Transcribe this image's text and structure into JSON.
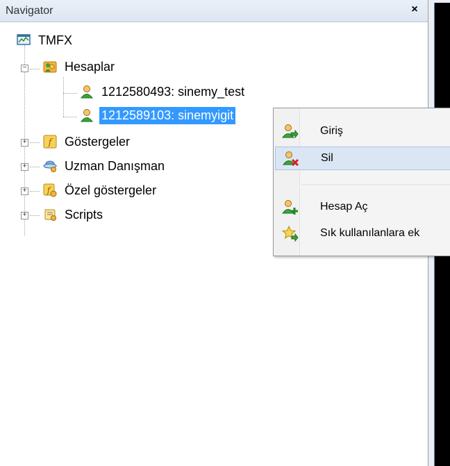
{
  "panel": {
    "title": "Navigator",
    "close_label": "×"
  },
  "tree": {
    "root": "TMFX",
    "accounts_group": "Hesaplar",
    "accounts": [
      {
        "label": "1212580493: sinemy_test",
        "selected": false
      },
      {
        "label": "1212589103: sinemyigit",
        "selected": true
      }
    ],
    "groups": [
      {
        "label": "Göstergeler",
        "icon": "indicator-icon"
      },
      {
        "label": "Uzman Danışman",
        "icon": "expert-advisor-icon"
      },
      {
        "label": "Özel göstergeler",
        "icon": "custom-indicator-icon"
      },
      {
        "label": "Scripts",
        "icon": "script-icon"
      }
    ]
  },
  "context_menu": {
    "items": [
      {
        "label": "Giriş",
        "icon": "user-login-icon"
      },
      {
        "label": "Sil",
        "icon": "user-delete-icon",
        "highlighted": true
      },
      {
        "label": "Hesap Aç",
        "icon": "user-add-icon"
      },
      {
        "label": "Sık kullanılanlara ek",
        "icon": "favorite-star-icon"
      }
    ]
  },
  "colors": {
    "selection": "#3399ff",
    "menu_hover": "#dbe6f4"
  }
}
